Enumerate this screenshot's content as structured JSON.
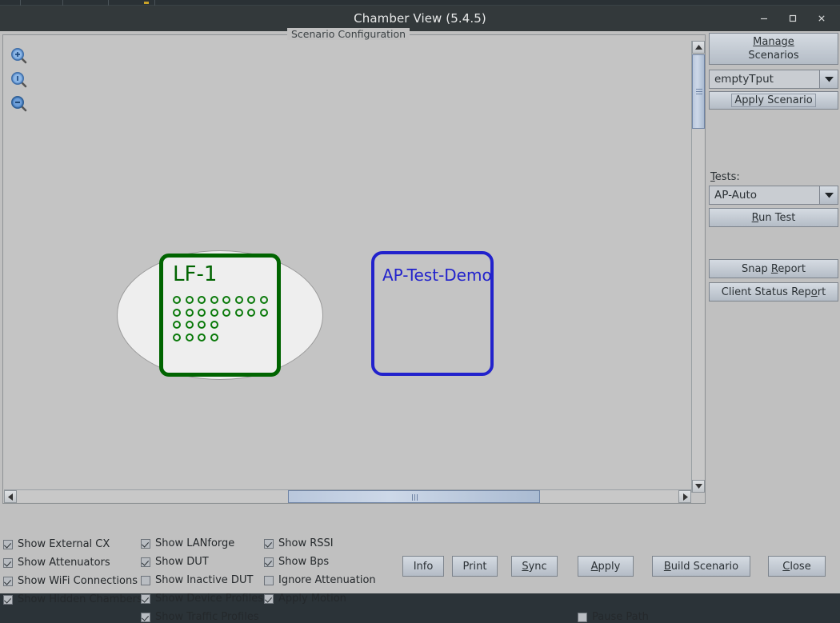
{
  "window": {
    "title": "Chamber View (5.4.5)",
    "minimize_label": "minimize",
    "maximize_label": "maximize",
    "close_label": "close"
  },
  "panel": {
    "group_title": "Scenario Configuration"
  },
  "canvas": {
    "zoom_in_label": "zoom-in",
    "zoom_reset_label": "zoom-reset",
    "zoom_out_label": "zoom-out",
    "nodes": [
      {
        "id": "lf-1",
        "label": "LF-1",
        "color": "#006400",
        "shape": "chamber",
        "dot_rows": [
          8,
          8,
          4,
          4
        ]
      },
      {
        "id": "ap-test-demo",
        "label": "AP-Test-Demo",
        "color": "#2222cc",
        "shape": "dut"
      }
    ]
  },
  "sidebar": {
    "manage_scenarios_label": "Manage\nScenarios",
    "manage_scenarios_line1": "Manage",
    "manage_scenarios_line2": "Scenarios",
    "scenario_value": "emptyTput",
    "apply_scenario_label": "Apply Scenario",
    "tests_label": "Tests:",
    "tests_value": "AP-Auto",
    "run_test_label": "Run Test",
    "snap_report_label": "Snap Report",
    "client_status_report_label": "Client Status Report"
  },
  "checkboxes": {
    "column1": [
      {
        "label": "Show External CX",
        "checked": true
      },
      {
        "label": "Show Attenuators",
        "checked": true
      },
      {
        "label": "Show WiFi Connections",
        "checked": true
      },
      {
        "label": "Show Hidden Chambers",
        "checked": true
      }
    ],
    "column2": [
      {
        "label": "Show LANforge",
        "checked": true
      },
      {
        "label": "Show DUT",
        "checked": true
      },
      {
        "label": "Show Inactive DUT",
        "checked": false
      },
      {
        "label": "Show Device Profiles",
        "checked": true
      },
      {
        "label": "Show Traffic Profiles",
        "checked": true
      }
    ],
    "column3": [
      {
        "label": "Show RSSI",
        "checked": true
      },
      {
        "label": "Show Bps",
        "checked": true
      },
      {
        "label": "Ignore Attenuation",
        "checked": false
      },
      {
        "label": "Apply Motion",
        "checked": true
      }
    ],
    "pause_path": {
      "label": "Pause Path",
      "checked": false
    }
  },
  "actions": [
    {
      "label": "Info"
    },
    {
      "label": "Print"
    },
    {
      "label": "Sync"
    },
    {
      "label": "Apply"
    },
    {
      "label": "Build Scenario"
    },
    {
      "label": "Close"
    }
  ]
}
